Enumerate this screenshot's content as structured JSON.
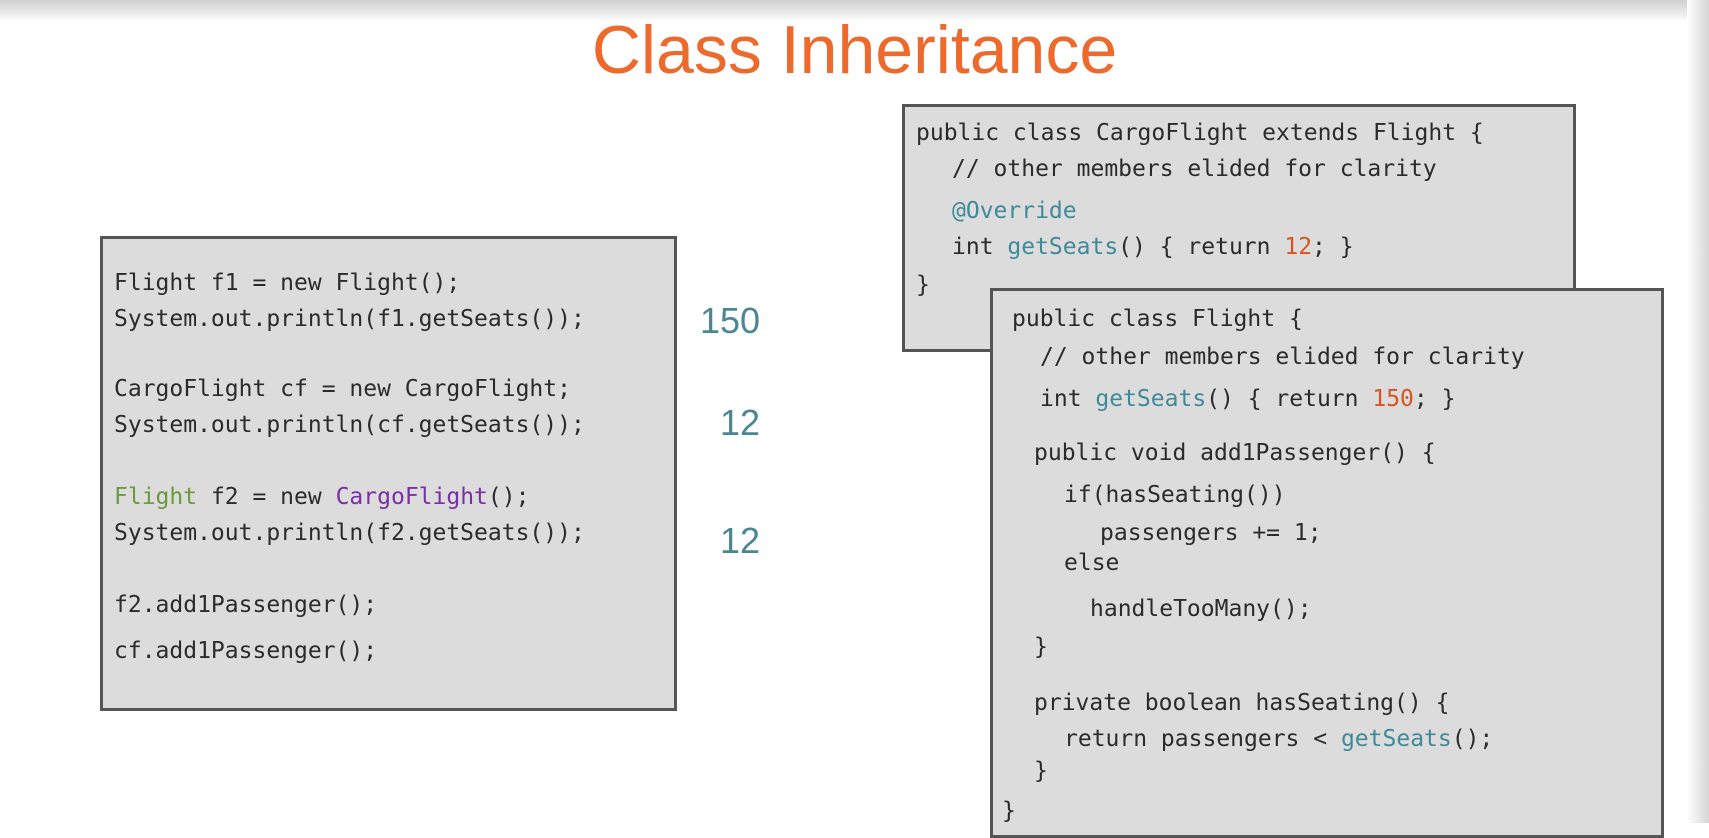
{
  "slide": {
    "title": "Class Inheritance"
  },
  "main_code": {
    "line1": "Flight f1 = new Flight();",
    "line2": "System.out.println(f1.getSeats());",
    "line3": "CargoFlight cf = new CargoFlight;",
    "line4": "System.out.println(cf.getSeats());",
    "line5_type": "Flight",
    "line5_mid": " f2 = new ",
    "line5_class": "CargoFlight",
    "line5_end": "();",
    "line6": "System.out.println(f2.getSeats());",
    "line7": "f2.add1Passenger();",
    "line8": "cf.add1Passenger();"
  },
  "outputs": {
    "out1": "150",
    "out2": "12",
    "out3": "12"
  },
  "cargo_code": {
    "decl": "public class CargoFlight extends Flight {",
    "comment": "// other members elided for clarity",
    "annotation": "@Override",
    "m_type": "int ",
    "m_name": "getSeats",
    "m_mid": "() { return ",
    "m_val": "12",
    "m_end": "; }",
    "close": "}"
  },
  "flight_code": {
    "decl": "public class Flight {",
    "comment": "// other members elided for clarity",
    "m_type": "int ",
    "m_name": "getSeats",
    "m_mid": "() { return ",
    "m_val": "150",
    "m_end": "; }",
    "add_decl": "public void add1Passenger() {",
    "if_line": "if(hasSeating())",
    "inc_line": "passengers += 1;",
    "else_line": "else",
    "handle_line": "handleTooMany();",
    "close_method": "}",
    "has_decl": "private boolean hasSeating() {",
    "ret_pre": "return passengers < ",
    "ret_call": "getSeats",
    "ret_end": "();",
    "close_method2": "}",
    "close": "}"
  }
}
